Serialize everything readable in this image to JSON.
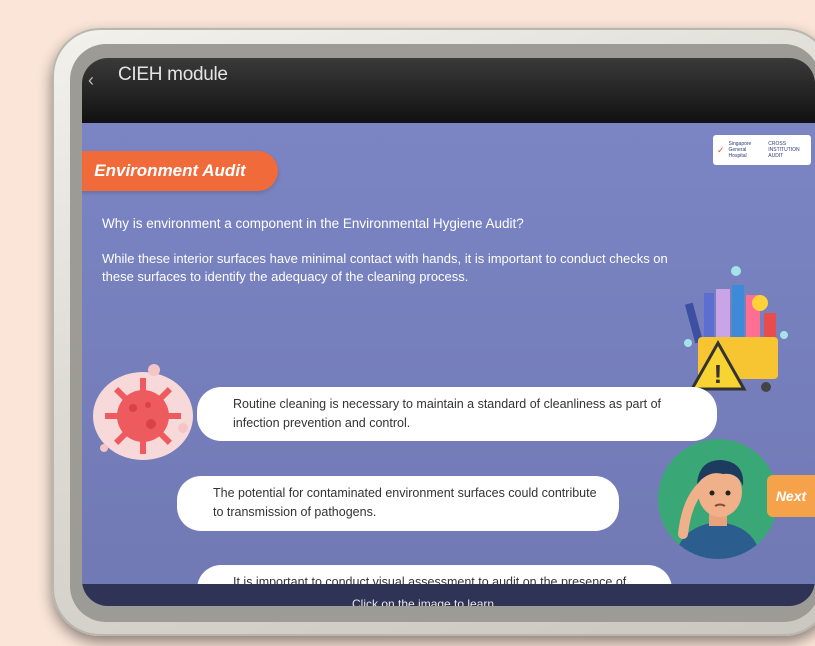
{
  "header": {
    "back_icon": "chevron-left-icon",
    "title": "CIEH module"
  },
  "badge": {
    "label": "Environment Audit"
  },
  "logo": {
    "text_left": "Singapore General Hospital",
    "text_right": "CROSS INSTITUTION AUDIT"
  },
  "main": {
    "question": "Why is environment a component in the Environmental Hygiene Audit?",
    "paragraph": "While these interior surfaces have minimal contact with hands, it is important to conduct checks on these surfaces to identify the adequacy of the cleaning process.",
    "points": [
      "Routine cleaning is necessary to maintain a standard of cleanliness as part of infection prevention and control.",
      "The potential for contaminated environment surfaces could contribute to transmission of pathogens.",
      "It is important to conduct visual assessment to audit on the presence of blood stains and dust in the environment."
    ]
  },
  "nav": {
    "next_label": "Next"
  },
  "footer": {
    "caption": "Click on the image to learn"
  },
  "icons": {
    "cleaning": "cleaning-cart-icon",
    "virus": "virus-icon",
    "person": "thinking-person-icon"
  },
  "colors": {
    "accent": "#f06a3a",
    "background": "#7b85c4",
    "next": "#f5a24a"
  }
}
